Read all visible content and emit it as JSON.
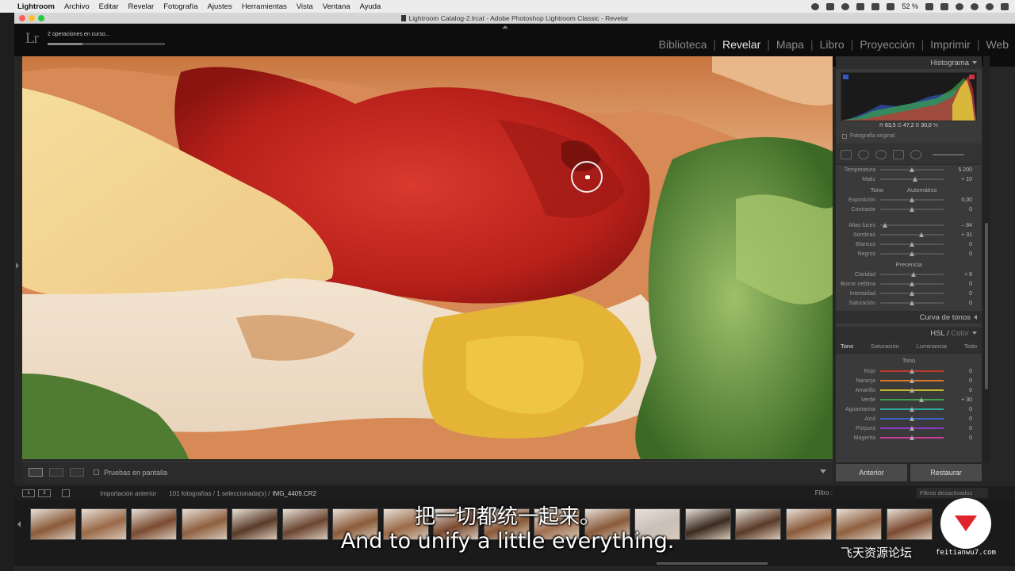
{
  "menubar": {
    "items": [
      "Lightroom",
      "Archivo",
      "Editar",
      "Revelar",
      "Fotografía",
      "Ajustes",
      "Herramientas",
      "Vista",
      "Ventana",
      "Ayuda"
    ],
    "battery": "52 %"
  },
  "window": {
    "title": "Lightroom Catalog-2.lrcat - Adobe Photoshop Lightroom Classic - Revelar"
  },
  "lr": {
    "logo": "Lr",
    "activity": "2 operaciones en curso...",
    "progress": 0.3,
    "modules": [
      "Biblioteca",
      "Revelar",
      "Mapa",
      "Libro",
      "Proyección",
      "Imprimir",
      "Web"
    ],
    "active_module": "Revelar"
  },
  "toolbar": {
    "soft_proof": "Pruebas en pantalla"
  },
  "histogram": {
    "title": "Histograma",
    "r_label": "R",
    "r": "63,5",
    "g_label": "G",
    "g": "47,2",
    "b_label": "B",
    "b": "30,0",
    "unit": "%",
    "original": "Fotografía original"
  },
  "basic": {
    "rows_top": [
      {
        "label": "Temperatura",
        "value": "5.200",
        "pos": 0.5
      },
      {
        "label": "Matiz",
        "value": "+ 10",
        "pos": 0.55
      }
    ],
    "tone_label": "Tono",
    "auto_label": "Automático",
    "tone_rows": [
      {
        "label": "Exposición",
        "value": "0,00",
        "pos": 0.5
      },
      {
        "label": "Contraste",
        "value": "0",
        "pos": 0.5
      }
    ],
    "tone_rows2": [
      {
        "label": "Altas luces",
        "value": "– 84",
        "pos": 0.08
      },
      {
        "label": "Sombras",
        "value": "+ 31",
        "pos": 0.65
      },
      {
        "label": "Blancos",
        "value": "0",
        "pos": 0.5
      },
      {
        "label": "Negros",
        "value": "0",
        "pos": 0.5
      }
    ],
    "presence_label": "Presencia",
    "presence_rows": [
      {
        "label": "Claridad",
        "value": "+ 6",
        "pos": 0.53
      },
      {
        "label": "Borrar neblina",
        "value": "0",
        "pos": 0.5
      },
      {
        "label": "Intensidad",
        "value": "0",
        "pos": 0.5
      },
      {
        "label": "Saturación",
        "value": "0",
        "pos": 0.5
      }
    ]
  },
  "panels": {
    "tone_curve": "Curva de tonos",
    "hsl": "HSL",
    "hsl_sep": "/",
    "color": "Color",
    "hsl_tabs": [
      "Tono",
      "Saturación",
      "Luminancia",
      "Todo"
    ],
    "hsl_sub": "Tono",
    "hsl_rows": [
      {
        "label": "Rojo",
        "value": "0",
        "pos": 0.5,
        "color": "#c0392b"
      },
      {
        "label": "Naranja",
        "value": "0",
        "pos": 0.5,
        "color": "#d87b2a"
      },
      {
        "label": "Amarillo",
        "value": "0",
        "pos": 0.5,
        "color": "#c9b82a"
      },
      {
        "label": "Verde",
        "value": "+ 30",
        "pos": 0.65,
        "color": "#3fa34d"
      },
      {
        "label": "Aguamarina",
        "value": "0",
        "pos": 0.5,
        "color": "#2aa9a0"
      },
      {
        "label": "Azul",
        "value": "0",
        "pos": 0.5,
        "color": "#3a64c8"
      },
      {
        "label": "Púrpura",
        "value": "0",
        "pos": 0.5,
        "color": "#8a3ac8"
      },
      {
        "label": "Magenta",
        "value": "0",
        "pos": 0.5,
        "color": "#c83a9a"
      }
    ]
  },
  "buttons": {
    "previous": "Anterior",
    "reset": "Restaurar"
  },
  "filmstrip": {
    "page1": "1",
    "page2": "2",
    "source": "Importación anterior",
    "info": "101 fotografías / 1 seleccionada(s) /",
    "file": "IMG_4409.CR2",
    "filter_label": "Filtro :",
    "filter_value": "Filtros desactivados"
  },
  "subtitles": {
    "cn": "把一切都统一起来。",
    "en": "And to unify a little everything."
  },
  "watermark": {
    "text": "飞天资源论坛",
    "url": "feitianwu7.com"
  }
}
